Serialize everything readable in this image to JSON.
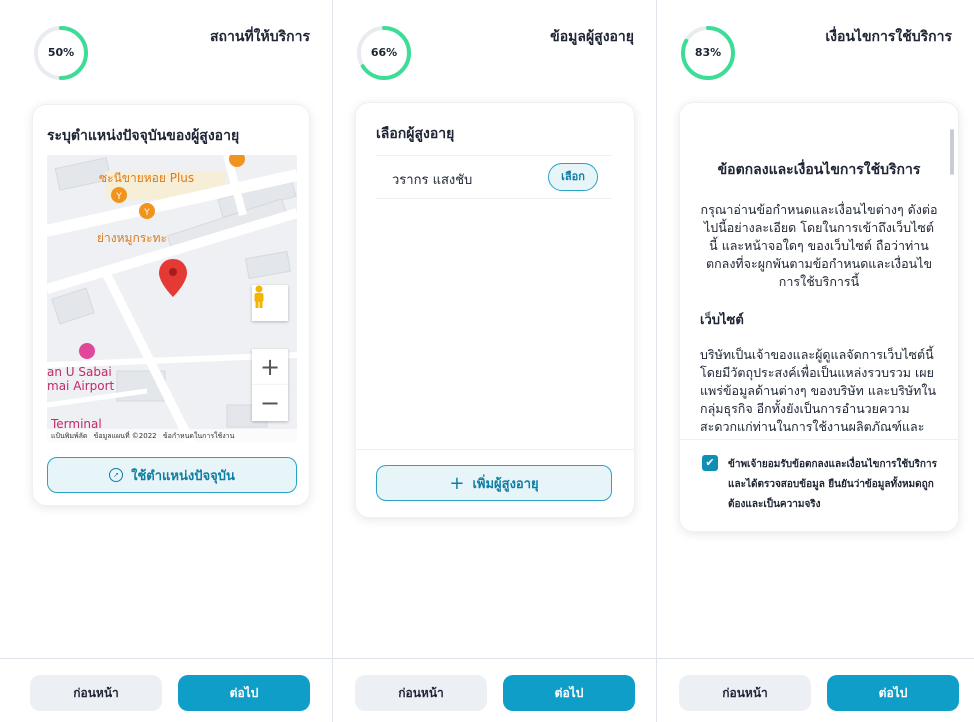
{
  "colors": {
    "accent": "#0f9ec8",
    "progress": "#3ddc97",
    "ring_track": "#e8ebf0"
  },
  "steps": [
    {
      "progress_label": "50%",
      "progress_value": 0.5,
      "title": "สถานที่ให้บริการ",
      "card_title": "ระบุตำแหน่งปัจจุบันของผู้สูงอายุ",
      "map": {
        "labels": {
          "shop": "ซะนีขายหอย Plus",
          "bbq": "ย่างหมูกระทะ",
          "hotel_line1": "an U Sabai",
          "hotel_line2": "mai Airport",
          "terminal": "Terminal"
        },
        "attribution": {
          "keyboard": "แป้นพิมพ์ลัด",
          "data": "ข้อมูลแผนที่ ©2022",
          "terms": "ข้อกำหนดในการใช้งาน"
        },
        "zoom_in": "+",
        "zoom_out": "−",
        "icons": [
          "map-pin-icon",
          "pegman-icon",
          "restaurant-icon"
        ]
      },
      "locate_button": "ใช้ตำแหน่งปัจจุบัน",
      "prev": "ก่อนหน้า",
      "next": "ต่อไป"
    },
    {
      "progress_label": "66%",
      "progress_value": 0.66,
      "title": "ข้อมูลผู้สูงอายุ",
      "card_title": "เลือกผู้สูงอายุ",
      "elders": [
        {
          "name": "วรากร แสงชับ",
          "action": "เลือก"
        }
      ],
      "add_button": "เพิ่มผู้สูงอายุ",
      "prev": "ก่อนหน้า",
      "next": "ต่อไป"
    },
    {
      "progress_label": "83%",
      "progress_value": 0.83,
      "title": "เงื่อนไขการใช้บริการ",
      "terms_title": "ข้อตกลงและเงื่อนไขการใช้บริการ",
      "terms_intro": "กรุณาอ่านข้อกำหนดและเงื่อนไขต่างๆ ดังต่อไปนี้อย่างละเอียด โดยในการเข้าถึงเว็บไซต์นี้ และหน้าจอใดๆ ของเว็บไซต์ ถือว่าท่านตกลงที่จะผูกพันตามข้อกำหนดและเงื่อนไขการใช้บริการนี้",
      "terms_subheading": "เว็บไซต์",
      "terms_body": "บริษัทเป็นเจ้าของและผู้ดูแลจัดการเว็บไซต์นี้ โดยมีวัตถุประสงค์เพื่อเป็นแหล่งรวบรวม เผยแพร่ข้อมูลด้านต่างๆ ของบริษัท และบริษัทในกลุ่มธุรกิจ อีกทั้งยังเป็นการอำนวยความสะดวกแก่ท่านในการใช้งานผลิตภัณฑ์และบริการต่างๆ",
      "consent_checked": true,
      "consent_text": "ข้าพเจ้ายอมรับข้อตกลงและเงื่อนไขการใช้บริการ และได้ตรวจสอบข้อมูล ยืนยันว่าข้อมูลทั้งหมดถูกต้องและเป็นความจริง",
      "prev": "ก่อนหน้า",
      "next": "ต่อไป"
    }
  ]
}
